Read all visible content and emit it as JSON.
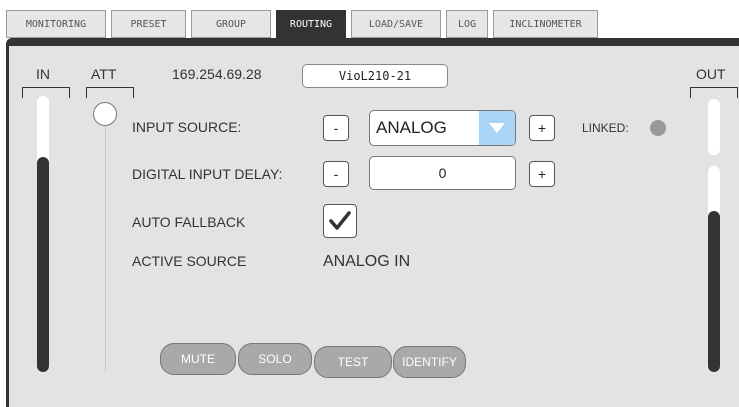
{
  "tabs": [
    {
      "label": "MONITORING"
    },
    {
      "label": "PRESET"
    },
    {
      "label": "GROUP"
    },
    {
      "label": "ROUTING",
      "active": true
    },
    {
      "label": "LOAD/SAVE"
    },
    {
      "label": "LOG"
    },
    {
      "label": "INCLINOMETER"
    }
  ],
  "header": {
    "in_label": "IN",
    "att_label": "ATT",
    "ip": "169.254.69.28",
    "device_name": "VioL210-21",
    "out_label": "OUT"
  },
  "rows": {
    "input_source": {
      "label": "INPUT SOURCE:",
      "minus": "-",
      "value": "ANALOG",
      "plus": "+",
      "linked_label": "LINKED:"
    },
    "digital_delay": {
      "label": "DIGITAL INPUT DELAY:",
      "minus": "-",
      "value": "0",
      "plus": "+"
    },
    "auto_fallback": {
      "label": "AUTO FALLBACK",
      "checked": true
    },
    "active_source": {
      "label": "ACTIVE SOURCE",
      "value": "ANALOG IN"
    }
  },
  "buttons": {
    "mute": "MUTE",
    "solo": "SOLO",
    "test": "TEST",
    "identify": "IDENTIFY"
  },
  "meters": {
    "in_level": 0.78,
    "out_upper_level": 0.0,
    "out_lower_level": 0.78
  },
  "colors": {
    "accent": "#333333",
    "panel": "#e3e3e3",
    "dropdown_arrow": "#a9d4f5",
    "linked_led": "#999999"
  }
}
